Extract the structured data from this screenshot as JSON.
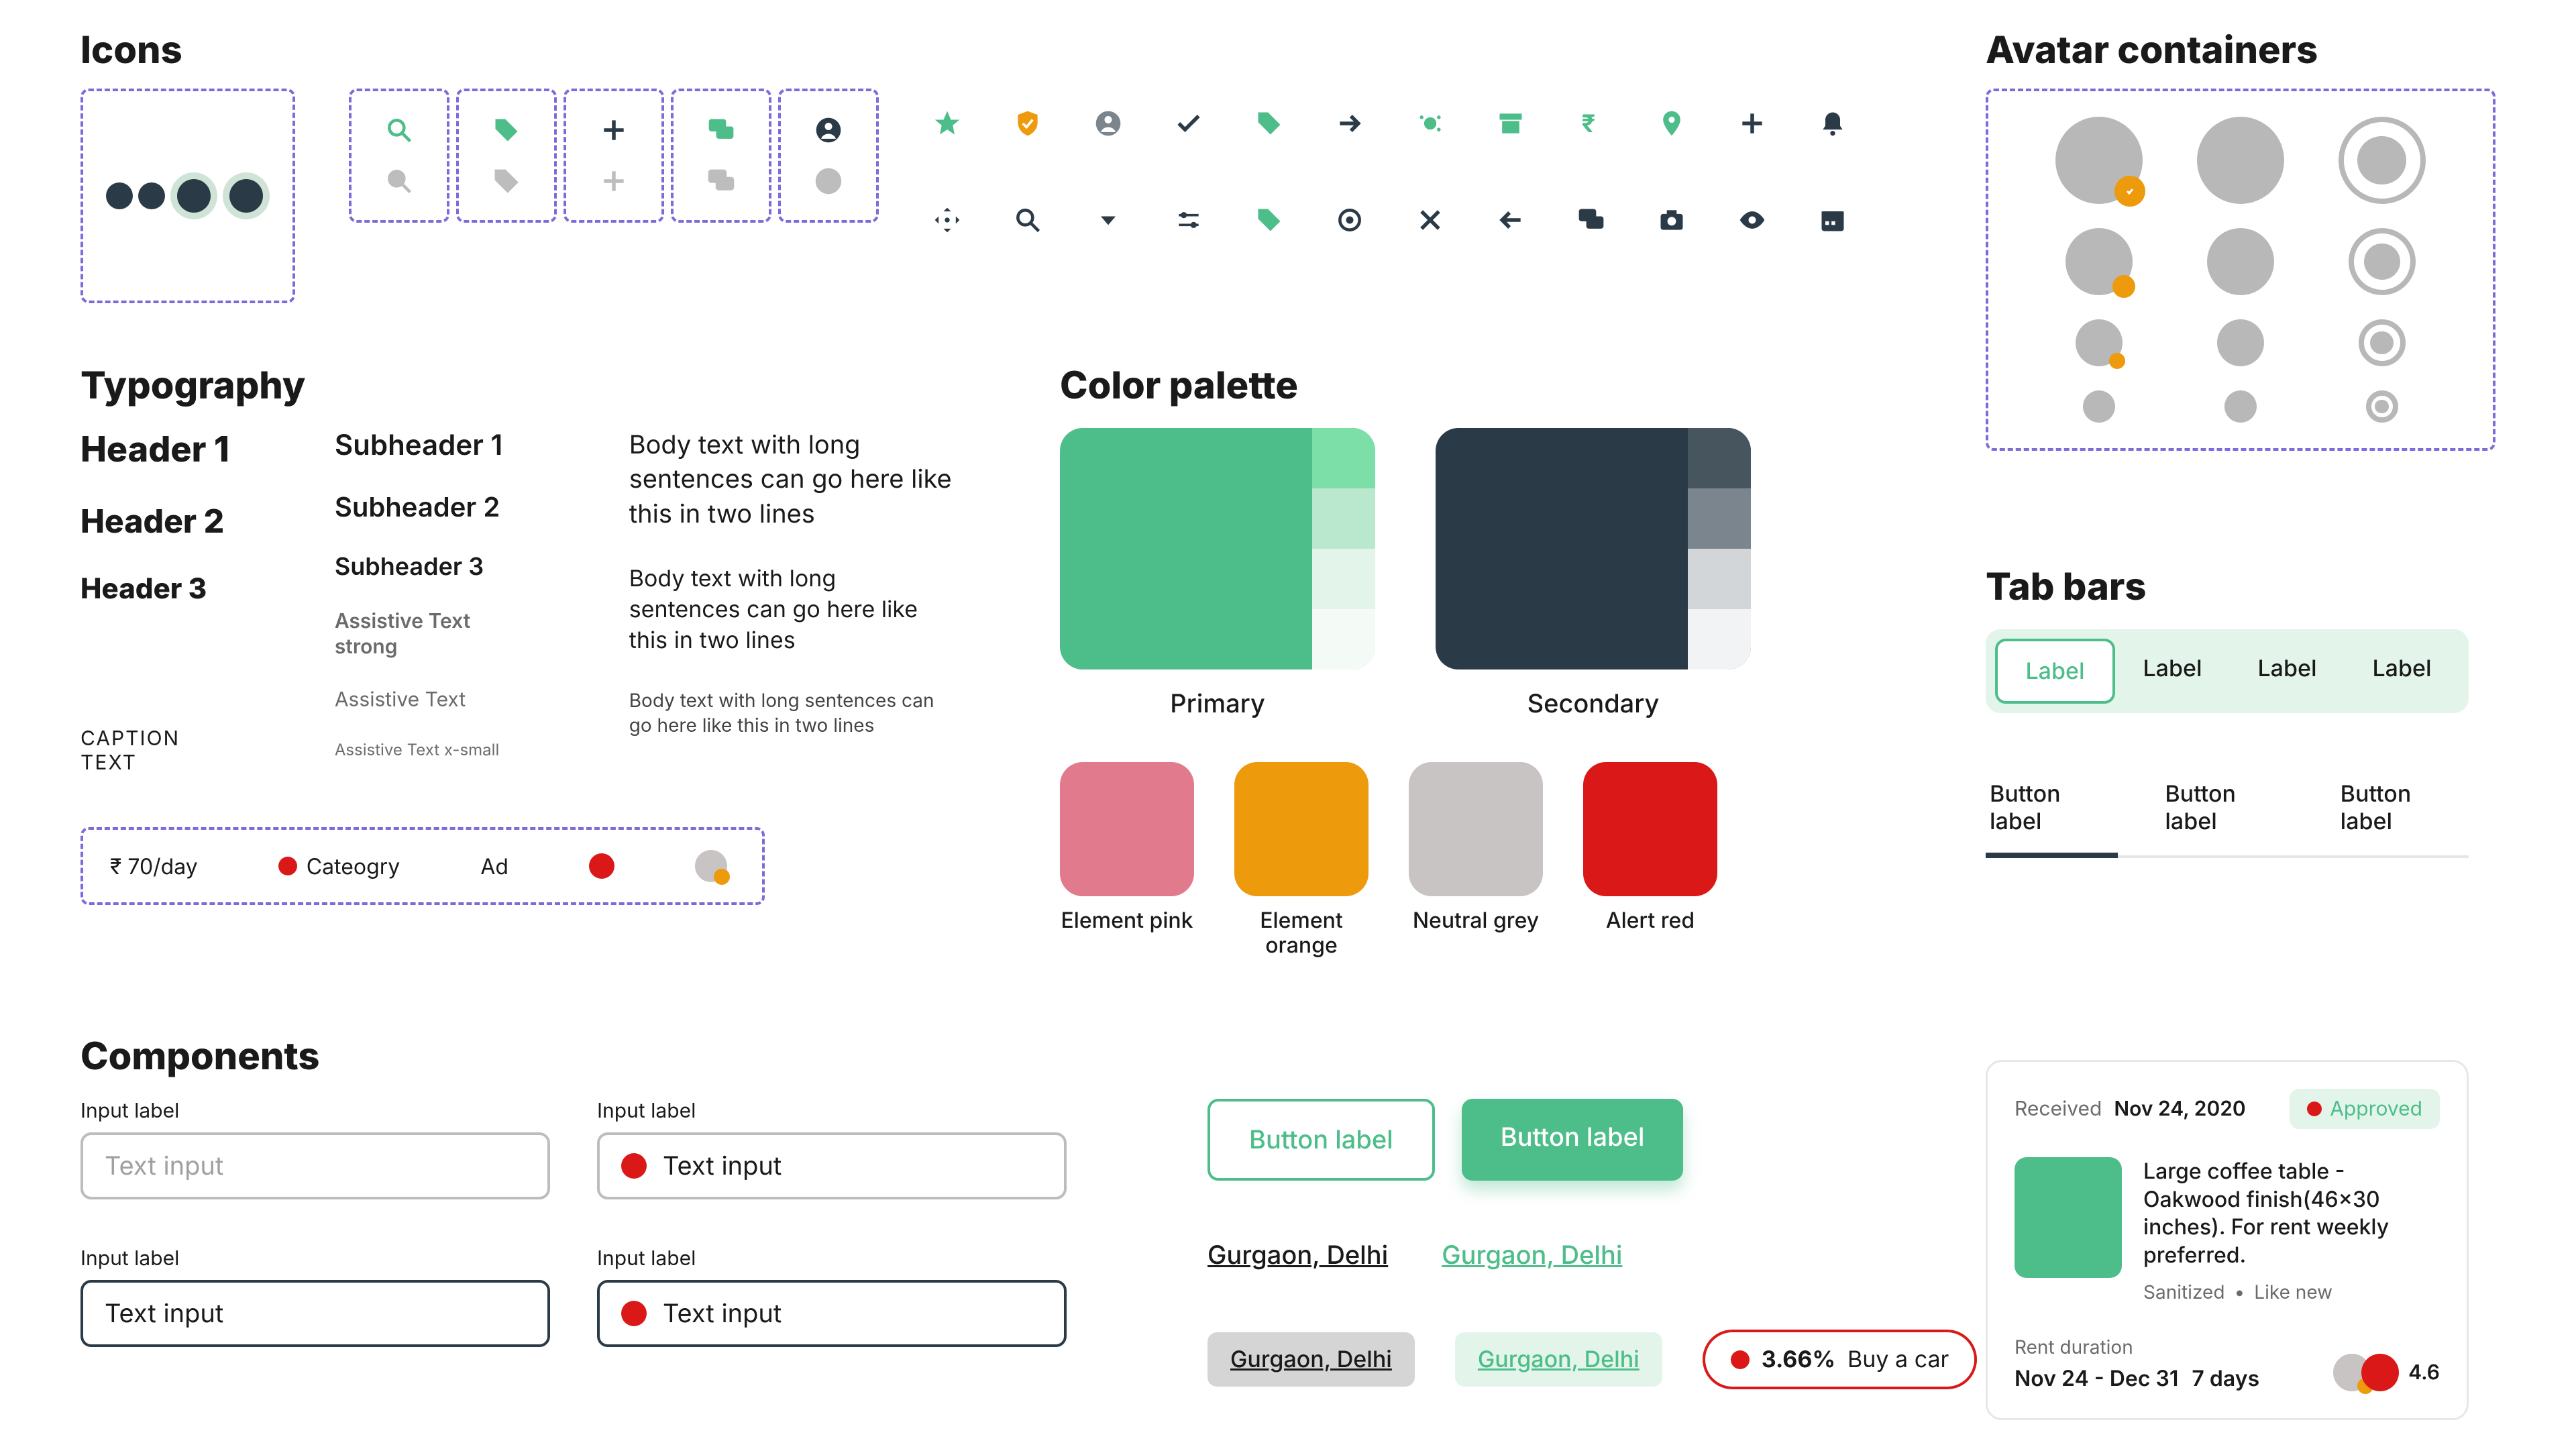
{
  "sections": {
    "icons": "Icons",
    "typography": "Typography",
    "palette": "Color palette",
    "avatars": "Avatar containers",
    "tabs": "Tab bars",
    "components": "Components"
  },
  "typography": {
    "h1": "Header 1",
    "h2": "Header 2",
    "h3": "Header 3",
    "sh1": "Subheader 1",
    "sh2": "Subheader 2",
    "sh3": "Subheader 3",
    "ast": "Assistive Text strong",
    "as": "Assistive Text",
    "asx": "Assistive Text x-small",
    "cap": "CAPTION TEXT",
    "b1": "Body text with long sentences can go here like this in two lines",
    "b2": "Body text with long sentences can go here like this in two lines",
    "b3": "Body text with long sentences can go here like this in two lines"
  },
  "chips": {
    "price": "₹ 70/day",
    "category": "Cateogry",
    "ad": "Ad"
  },
  "palette": {
    "primary": "Primary",
    "secondary": "Secondary",
    "pink": "Element pink",
    "orange": "Element orange",
    "neutral": "Neutral grey",
    "red": "Alert red"
  },
  "colors": {
    "primary": "#4dbd89",
    "primary_s1": "#7ddfa8",
    "primary_s2": "#b9e8ce",
    "primary_s3": "#e3f5eb",
    "primary_s4": "#f4fbf7",
    "secondary": "#2a3a47",
    "secondary_s1": "#47555f",
    "secondary_s2": "#7a858d",
    "secondary_s3": "#d2d6d9",
    "secondary_s4": "#f2f3f4",
    "pink": "#e27a8e",
    "orange": "#ed9a0c",
    "neutral": "#c8c4c4",
    "red": "#db1818"
  },
  "tabs": {
    "pill": [
      "Label",
      "Label",
      "Label",
      "Label"
    ],
    "under": [
      "Button label",
      "Button label",
      "Button label"
    ]
  },
  "components": {
    "input_label": "Input label",
    "placeholder": "Text input",
    "filled": "Text input",
    "btn_label": "Button label",
    "link": "Gurgaon, Delhi",
    "pill_pct": "3.66%",
    "pill_cta": "Buy a car"
  },
  "card": {
    "received_label": "Received",
    "received_date": "Nov 24, 2020",
    "status": "Approved",
    "title": "Large coffee table - Oakwood finish(46x30 inches). For rent weekly preferred.",
    "cond1": "Sanitized",
    "cond_sep": "•",
    "cond2": "Like new",
    "dur_label": "Rent duration",
    "dur_dates": "Nov 24 - Dec 31",
    "dur_days": "7 days",
    "rating": "4.6"
  }
}
